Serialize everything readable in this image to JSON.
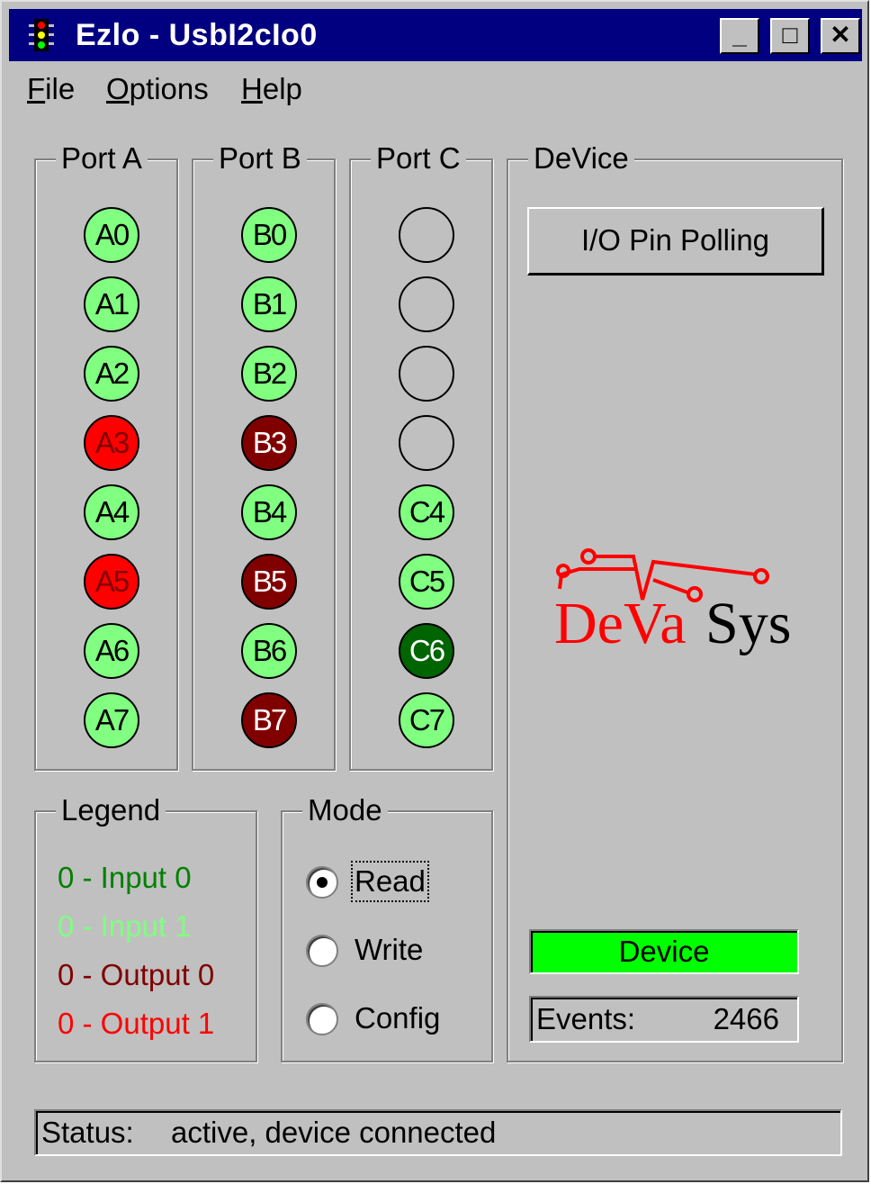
{
  "window": {
    "title": "Ezlo - UsbI2cIo0",
    "minimize_glyph": "_",
    "maximize_glyph": "□",
    "close_glyph": "✕"
  },
  "menu": [
    "File",
    "Options",
    "Help"
  ],
  "ports": [
    {
      "title": "Port A",
      "leds": [
        {
          "label": "A0",
          "state": "in1"
        },
        {
          "label": "A1",
          "state": "in1"
        },
        {
          "label": "A2",
          "state": "in1"
        },
        {
          "label": "A3",
          "state": "out1"
        },
        {
          "label": "A4",
          "state": "in1"
        },
        {
          "label": "A5",
          "state": "out1"
        },
        {
          "label": "A6",
          "state": "in1"
        },
        {
          "label": "A7",
          "state": "in1"
        }
      ]
    },
    {
      "title": "Port B",
      "leds": [
        {
          "label": "B0",
          "state": "in1"
        },
        {
          "label": "B1",
          "state": "in1"
        },
        {
          "label": "B2",
          "state": "in1"
        },
        {
          "label": "B3",
          "state": "out0"
        },
        {
          "label": "B4",
          "state": "in1"
        },
        {
          "label": "B5",
          "state": "out0"
        },
        {
          "label": "B6",
          "state": "in1"
        },
        {
          "label": "B7",
          "state": "out0"
        }
      ]
    },
    {
      "title": "Port C",
      "leds": [
        {
          "label": "",
          "state": "off"
        },
        {
          "label": "",
          "state": "off"
        },
        {
          "label": "",
          "state": "off"
        },
        {
          "label": "",
          "state": "off"
        },
        {
          "label": "C4",
          "state": "in1"
        },
        {
          "label": "C5",
          "state": "in1"
        },
        {
          "label": "C6",
          "state": "dk"
        },
        {
          "label": "C7",
          "state": "in1"
        }
      ]
    }
  ],
  "legend": {
    "title": "Legend",
    "items": [
      {
        "text": "0 - Input 0",
        "color": "#008000"
      },
      {
        "text": "0 - Input 1",
        "color": "#80ff80"
      },
      {
        "text": "0 - Output 0",
        "color": "#800000"
      },
      {
        "text": "0 - Output 1",
        "color": "#ff0000"
      }
    ]
  },
  "mode": {
    "title": "Mode",
    "options": [
      {
        "label": "Read",
        "selected": true
      },
      {
        "label": "Write",
        "selected": false
      },
      {
        "label": "Config",
        "selected": false
      }
    ]
  },
  "device": {
    "title": "DeVice",
    "polling_button": "I/O Pin Polling",
    "logo_text_red": "DeVa",
    "logo_text_black": "Sys",
    "status_label": "Device",
    "status_color": "#00ff00",
    "events_label": "Events:",
    "events_value": "2466"
  },
  "statusbar": {
    "label": "Status:",
    "text": "active, device connected"
  }
}
